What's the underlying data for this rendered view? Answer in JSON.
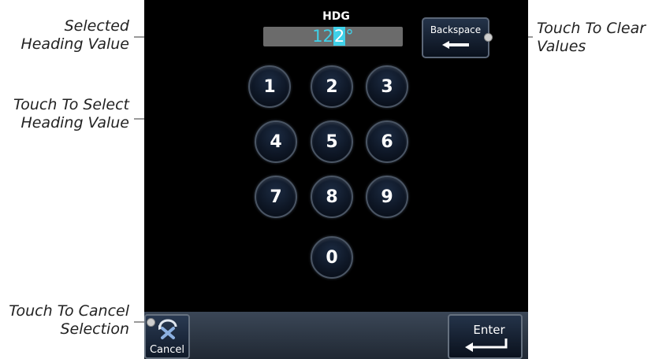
{
  "callouts": {
    "selected_value": [
      "Selected",
      "Heading Value"
    ],
    "select_value": [
      "Touch To Select",
      "Heading Value"
    ],
    "cancel_selection": [
      "Touch To Cancel",
      "Selection"
    ],
    "clear_values": [
      "Touch To Clear",
      "Values"
    ]
  },
  "screen": {
    "title": "HDG",
    "value_prefix": "12",
    "value_cursor": "2",
    "value_suffix": "°",
    "backspace_label": "Backspace",
    "cancel_label": "Cancel",
    "enter_label": "Enter",
    "keys": [
      "1",
      "2",
      "3",
      "4",
      "5",
      "6",
      "7",
      "8",
      "9",
      "0"
    ]
  },
  "colors": {
    "screen_bg": "#000000",
    "value_text": "#3fd0e8",
    "value_field": "#6b6b6b"
  },
  "icons": {
    "backspace": "left-arrow-icon",
    "cancel": "x-cancel-icon",
    "enter": "enter-return-icon"
  }
}
